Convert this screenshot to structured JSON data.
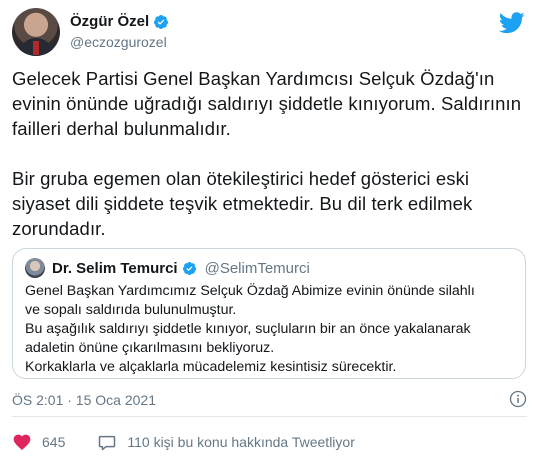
{
  "author": {
    "name": "Özgür Özel",
    "handle": "@eczozgurozel"
  },
  "tweet": {
    "paragraph1": "Gelecek Partisi Genel Başkan Yardımcısı Selçuk Özdağ'ın evinin önünde uğradığı saldırıyı şiddetle kınıyorum. Saldırının failleri derhal bulunmalıdır.",
    "paragraph2": "Bir gruba egemen olan ötekileştirici hedef gösterici eski siyaset dili şiddete teşvik etmektedir. Bu dil terk edilmek zorundadır."
  },
  "quoted_tweet": {
    "name": "Dr. Selim Temurci",
    "handle": "@SelimTemurci",
    "lines": [
      "Genel Başkan Yardımcımız Selçuk Özdağ Abimize evinin önünde silahlı",
      "ve sopalı saldırıda bulunulmuştur.",
      "Bu aşağılık saldırıyı şiddetle kınıyor, suçluların bir an önce yakalanarak",
      "adaletin önüne çıkarılmasını bekliyoruz.",
      "Korkaklarla ve alçaklarla mücadelemiz kesintisiz sürecektir."
    ]
  },
  "timestamp": "ÖS 2:01 · 15 Oca 2021",
  "actions": {
    "likes": "645",
    "discussion": "110 kişi bu konu hakkında Tweetliyor"
  },
  "icons": {
    "verified": "verified-badge-icon",
    "brand": "twitter-bird-icon",
    "info": "info-icon",
    "like": "heart-icon",
    "reply": "speech-bubble-icon"
  },
  "colors": {
    "brand": "#1da1f2",
    "like": "#e0245e",
    "muted": "#657786",
    "border": "#ccd6dd"
  }
}
